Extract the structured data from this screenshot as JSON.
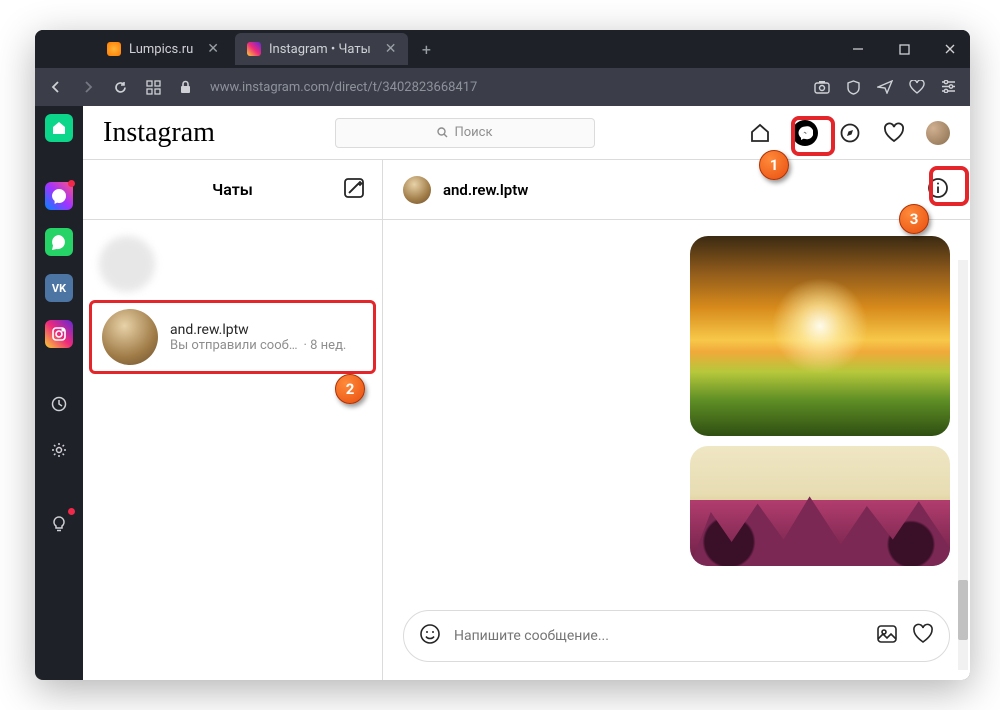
{
  "browser": {
    "tabs": [
      {
        "title": "Lumpics.ru",
        "favicon_color": "#ff9c00",
        "active": false
      },
      {
        "title": "Instagram • Чаты",
        "favicon_gradient": "instagram",
        "active": true
      }
    ],
    "url_host": "www.instagram.com",
    "url_path": "/direct/t/3402823668417"
  },
  "instagram": {
    "logo": "Instagram",
    "search_placeholder": "Поиск",
    "chats_header": "Чаты",
    "chat_list": [
      {
        "name": "",
        "preview": "",
        "avatar": "blurred"
      },
      {
        "name": "and.rew.lptw",
        "preview": "Вы отправили сооб…",
        "time": "· 8 нед."
      }
    ],
    "thread": {
      "name": "and.rew.lptw"
    },
    "composer_placeholder": "Напишите сообщение..."
  },
  "callouts": {
    "c1": "1",
    "c2": "2",
    "c3": "3"
  }
}
